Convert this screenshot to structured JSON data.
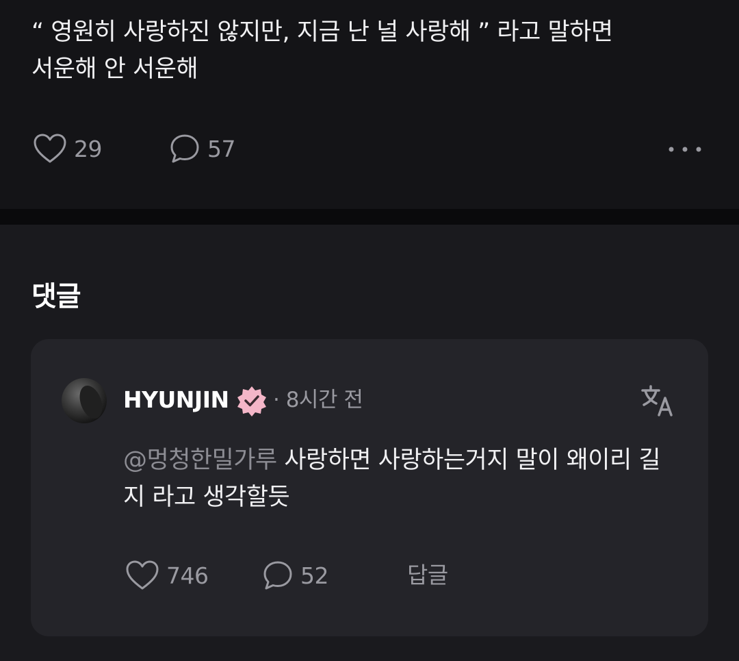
{
  "post": {
    "text": "“ 영원히 사랑하진 않지만, 지금 난 널 사랑해 ” 라고 말하면\n서운해 안 서운해",
    "like_count": "29",
    "comment_count": "57"
  },
  "comments": {
    "title": "댓글",
    "items": [
      {
        "username": "HYUNJIN",
        "timestamp": "· 8시간 전",
        "mention": "@멍청한밀가루",
        "text": " 사랑하면 사랑하는거지 말이 왜이리 길지 라고 생각할듯",
        "like_count": "746",
        "reply_count": "52",
        "reply_label": "답글"
      }
    ]
  },
  "colors": {
    "background": "#141417",
    "comments_background": "#1a1a1e",
    "card_background": "#242429",
    "badge_pink": "#f4b6c8",
    "muted_text": "#9a9aa1"
  },
  "icons": [
    "heart-icon",
    "comment-bubble-icon",
    "more-dots-icon",
    "verified-badge-icon",
    "translate-icon"
  ]
}
